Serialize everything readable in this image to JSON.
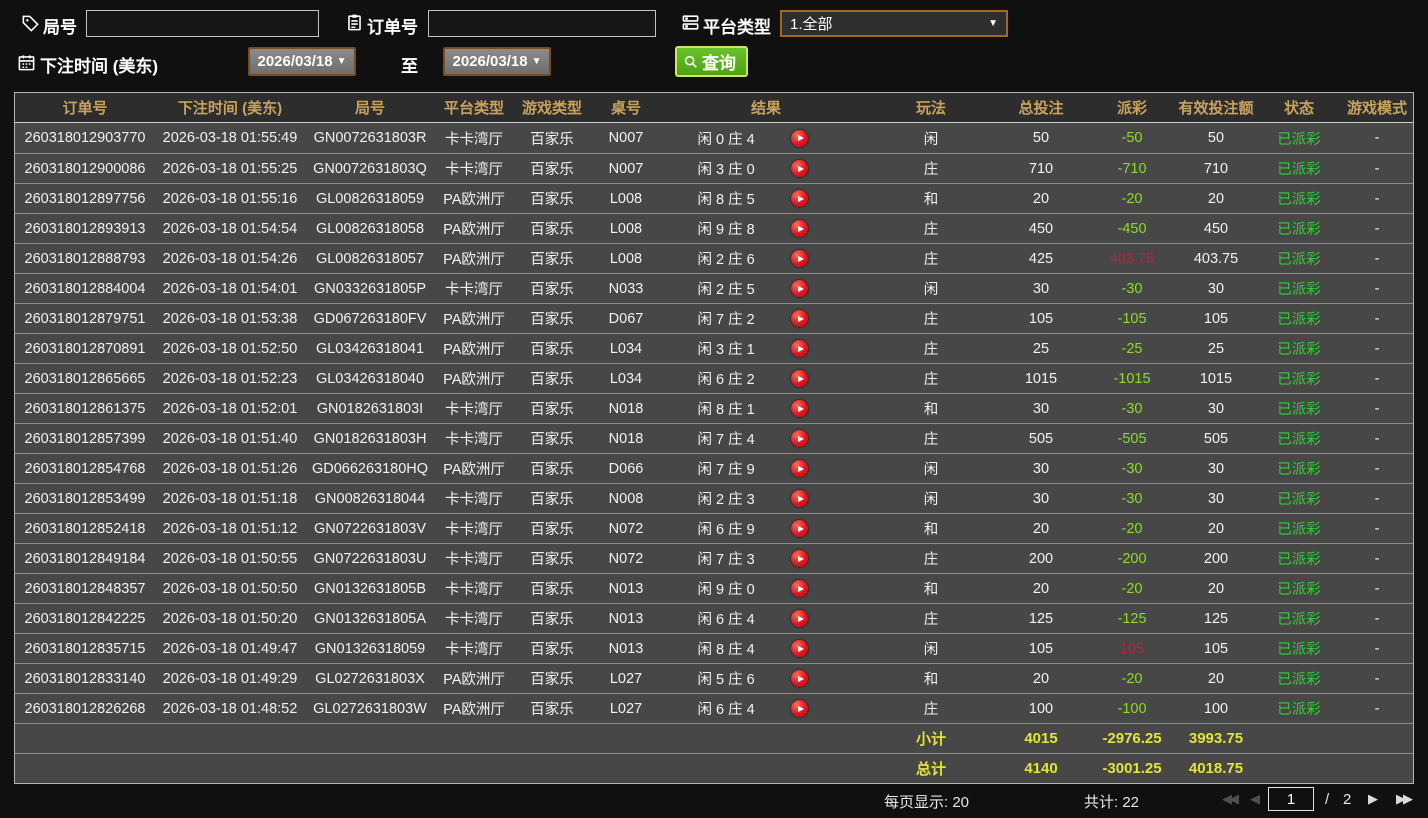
{
  "filters": {
    "game_no_label": "局号",
    "order_no_label": "订单号",
    "game_no_value": "",
    "order_no_value": "",
    "platform_label": "平台类型",
    "platform_value": "1.全部",
    "bet_time_label": "下注时间 (美东)",
    "date_from": "2026/03/18",
    "to_label": "至",
    "date_to": "2026/03/18",
    "search_label": "查询"
  },
  "icons": {
    "dropdown_arrow": "▼",
    "pager_first": "◀◀",
    "pager_prev": "◀",
    "pager_next": "▶",
    "pager_last": "▶▶"
  },
  "table": {
    "headers": [
      "订单号",
      "下注时间 (美东)",
      "局号",
      "平台类型",
      "游戏类型",
      "桌号",
      "结果",
      "玩法",
      "总投注",
      "派彩",
      "有效投注额",
      "状态",
      "游戏模式"
    ],
    "rows": [
      {
        "order": "260318012903770",
        "time": "2026-03-18 01:55:49",
        "round": "GN0072631803R",
        "platform": "卡卡湾厅",
        "game": "百家乐",
        "table": "N007",
        "result": "闲 0 庄 4",
        "bet_type": "闲",
        "total_bet": "50",
        "payout": "-50",
        "valid_bet": "50",
        "status": "已派彩",
        "mode": "-"
      },
      {
        "order": "260318012900086",
        "time": "2026-03-18 01:55:25",
        "round": "GN0072631803Q",
        "platform": "卡卡湾厅",
        "game": "百家乐",
        "table": "N007",
        "result": "闲 3 庄 0",
        "bet_type": "庄",
        "total_bet": "710",
        "payout": "-710",
        "valid_bet": "710",
        "status": "已派彩",
        "mode": "-"
      },
      {
        "order": "260318012897756",
        "time": "2026-03-18 01:55:16",
        "round": "GL00826318059",
        "platform": "PA欧洲厅",
        "game": "百家乐",
        "table": "L008",
        "result": "闲 8 庄 5",
        "bet_type": "和",
        "total_bet": "20",
        "payout": "-20",
        "valid_bet": "20",
        "status": "已派彩",
        "mode": "-"
      },
      {
        "order": "260318012893913",
        "time": "2026-03-18 01:54:54",
        "round": "GL00826318058",
        "platform": "PA欧洲厅",
        "game": "百家乐",
        "table": "L008",
        "result": "闲 9 庄 8",
        "bet_type": "庄",
        "total_bet": "450",
        "payout": "-450",
        "valid_bet": "450",
        "status": "已派彩",
        "mode": "-"
      },
      {
        "order": "260318012888793",
        "time": "2026-03-18 01:54:26",
        "round": "GL00826318057",
        "platform": "PA欧洲厅",
        "game": "百家乐",
        "table": "L008",
        "result": "闲 2 庄 6",
        "bet_type": "庄",
        "total_bet": "425",
        "payout": "403.75",
        "valid_bet": "403.75",
        "status": "已派彩",
        "mode": "-"
      },
      {
        "order": "260318012884004",
        "time": "2026-03-18 01:54:01",
        "round": "GN0332631805P",
        "platform": "卡卡湾厅",
        "game": "百家乐",
        "table": "N033",
        "result": "闲 2 庄 5",
        "bet_type": "闲",
        "total_bet": "30",
        "payout": "-30",
        "valid_bet": "30",
        "status": "已派彩",
        "mode": "-"
      },
      {
        "order": "260318012879751",
        "time": "2026-03-18 01:53:38",
        "round": "GD067263180FV",
        "platform": "PA欧洲厅",
        "game": "百家乐",
        "table": "D067",
        "result": "闲 7 庄 2",
        "bet_type": "庄",
        "total_bet": "105",
        "payout": "-105",
        "valid_bet": "105",
        "status": "已派彩",
        "mode": "-"
      },
      {
        "order": "260318012870891",
        "time": "2026-03-18 01:52:50",
        "round": "GL03426318041",
        "platform": "PA欧洲厅",
        "game": "百家乐",
        "table": "L034",
        "result": "闲 3 庄 1",
        "bet_type": "庄",
        "total_bet": "25",
        "payout": "-25",
        "valid_bet": "25",
        "status": "已派彩",
        "mode": "-"
      },
      {
        "order": "260318012865665",
        "time": "2026-03-18 01:52:23",
        "round": "GL03426318040",
        "platform": "PA欧洲厅",
        "game": "百家乐",
        "table": "L034",
        "result": "闲 6 庄 2",
        "bet_type": "庄",
        "total_bet": "1015",
        "payout": "-1015",
        "valid_bet": "1015",
        "status": "已派彩",
        "mode": "-"
      },
      {
        "order": "260318012861375",
        "time": "2026-03-18 01:52:01",
        "round": "GN0182631803I",
        "platform": "卡卡湾厅",
        "game": "百家乐",
        "table": "N018",
        "result": "闲 8 庄 1",
        "bet_type": "和",
        "total_bet": "30",
        "payout": "-30",
        "valid_bet": "30",
        "status": "已派彩",
        "mode": "-"
      },
      {
        "order": "260318012857399",
        "time": "2026-03-18 01:51:40",
        "round": "GN0182631803H",
        "platform": "卡卡湾厅",
        "game": "百家乐",
        "table": "N018",
        "result": "闲 7 庄 4",
        "bet_type": "庄",
        "total_bet": "505",
        "payout": "-505",
        "valid_bet": "505",
        "status": "已派彩",
        "mode": "-"
      },
      {
        "order": "260318012854768",
        "time": "2026-03-18 01:51:26",
        "round": "GD066263180HQ",
        "platform": "PA欧洲厅",
        "game": "百家乐",
        "table": "D066",
        "result": "闲 7 庄 9",
        "bet_type": "闲",
        "total_bet": "30",
        "payout": "-30",
        "valid_bet": "30",
        "status": "已派彩",
        "mode": "-"
      },
      {
        "order": "260318012853499",
        "time": "2026-03-18 01:51:18",
        "round": "GN00826318044",
        "platform": "卡卡湾厅",
        "game": "百家乐",
        "table": "N008",
        "result": "闲 2 庄 3",
        "bet_type": "闲",
        "total_bet": "30",
        "payout": "-30",
        "valid_bet": "30",
        "status": "已派彩",
        "mode": "-"
      },
      {
        "order": "260318012852418",
        "time": "2026-03-18 01:51:12",
        "round": "GN0722631803V",
        "platform": "卡卡湾厅",
        "game": "百家乐",
        "table": "N072",
        "result": "闲 6 庄 9",
        "bet_type": "和",
        "total_bet": "20",
        "payout": "-20",
        "valid_bet": "20",
        "status": "已派彩",
        "mode": "-"
      },
      {
        "order": "260318012849184",
        "time": "2026-03-18 01:50:55",
        "round": "GN0722631803U",
        "platform": "卡卡湾厅",
        "game": "百家乐",
        "table": "N072",
        "result": "闲 7 庄 3",
        "bet_type": "庄",
        "total_bet": "200",
        "payout": "-200",
        "valid_bet": "200",
        "status": "已派彩",
        "mode": "-"
      },
      {
        "order": "260318012848357",
        "time": "2026-03-18 01:50:50",
        "round": "GN0132631805B",
        "platform": "卡卡湾厅",
        "game": "百家乐",
        "table": "N013",
        "result": "闲 9 庄 0",
        "bet_type": "和",
        "total_bet": "20",
        "payout": "-20",
        "valid_bet": "20",
        "status": "已派彩",
        "mode": "-"
      },
      {
        "order": "260318012842225",
        "time": "2026-03-18 01:50:20",
        "round": "GN0132631805A",
        "platform": "卡卡湾厅",
        "game": "百家乐",
        "table": "N013",
        "result": "闲 6 庄 4",
        "bet_type": "庄",
        "total_bet": "125",
        "payout": "-125",
        "valid_bet": "125",
        "status": "已派彩",
        "mode": "-"
      },
      {
        "order": "260318012835715",
        "time": "2026-03-18 01:49:47",
        "round": "GN01326318059",
        "platform": "卡卡湾厅",
        "game": "百家乐",
        "table": "N013",
        "result": "闲 8 庄 4",
        "bet_type": "闲",
        "total_bet": "105",
        "payout": "105",
        "valid_bet": "105",
        "status": "已派彩",
        "mode": "-"
      },
      {
        "order": "260318012833140",
        "time": "2026-03-18 01:49:29",
        "round": "GL0272631803X",
        "platform": "PA欧洲厅",
        "game": "百家乐",
        "table": "L027",
        "result": "闲 5 庄 6",
        "bet_type": "和",
        "total_bet": "20",
        "payout": "-20",
        "valid_bet": "20",
        "status": "已派彩",
        "mode": "-"
      },
      {
        "order": "260318012826268",
        "time": "2026-03-18 01:48:52",
        "round": "GL0272631803W",
        "platform": "PA欧洲厅",
        "game": "百家乐",
        "table": "L027",
        "result": "闲 6 庄 4",
        "bet_type": "庄",
        "total_bet": "100",
        "payout": "-100",
        "valid_bet": "100",
        "status": "已派彩",
        "mode": "-"
      }
    ],
    "subtotal": {
      "label": "小计",
      "total_bet": "4015",
      "payout": "-2976.25",
      "valid_bet": "3993.75"
    },
    "total": {
      "label": "总计",
      "total_bet": "4140",
      "payout": "-3001.25",
      "valid_bet": "4018.75"
    }
  },
  "footer": {
    "per_page_label": "每页显示: 20",
    "total_count_label": "共计: 22",
    "current_page": "1",
    "page_separator": "/",
    "total_pages": "2"
  },
  "colors": {
    "header_text": "#c9a35e",
    "payout_negative": "#8ade22",
    "payout_positive": "#b3273f",
    "status_green": "#2fd132",
    "totals_yellow": "#e4e438",
    "search_button_green": "#5cb51e",
    "date_border_brown": "#7c4a1c"
  }
}
